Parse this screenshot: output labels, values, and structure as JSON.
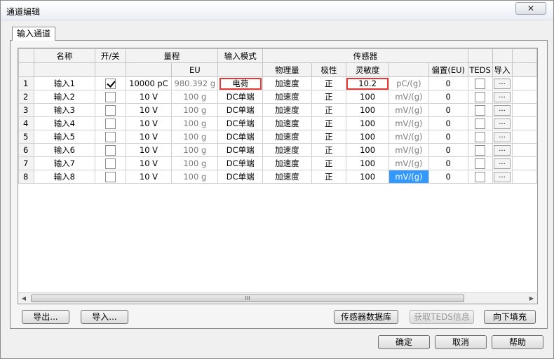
{
  "window": {
    "title": "通道编辑",
    "close_label": "✕"
  },
  "tab": {
    "label": "输入通道"
  },
  "headers": {
    "name": "名称",
    "onoff": "开/关",
    "range": "量程",
    "input_mode": "输入模式",
    "sensor": "传感器",
    "eu": "EU",
    "physical": "物理量",
    "polarity": "极性",
    "sensitivity": "灵敏度",
    "offset": "偏置(EU)",
    "teds": "TEDS",
    "import": "导入"
  },
  "rows": [
    {
      "num": "1",
      "name": "输入1",
      "checked": true,
      "range": "10000 pC",
      "eu": "980.392 g",
      "mode": "电荷",
      "phys": "加速度",
      "pol": "正",
      "sens": "10.2",
      "unit": "pC/(g)",
      "offset": "0",
      "btn": "..."
    },
    {
      "num": "2",
      "name": "输入2",
      "checked": false,
      "range": "10 V",
      "eu": "100 g",
      "mode": "DC单端",
      "phys": "加速度",
      "pol": "正",
      "sens": "100",
      "unit": "mV/(g)",
      "offset": "0",
      "btn": "..."
    },
    {
      "num": "3",
      "name": "输入3",
      "checked": false,
      "range": "10 V",
      "eu": "100 g",
      "mode": "DC单端",
      "phys": "加速度",
      "pol": "正",
      "sens": "100",
      "unit": "mV/(g)",
      "offset": "0",
      "btn": "..."
    },
    {
      "num": "4",
      "name": "输入4",
      "checked": false,
      "range": "10 V",
      "eu": "100 g",
      "mode": "DC单端",
      "phys": "加速度",
      "pol": "正",
      "sens": "100",
      "unit": "mV/(g)",
      "offset": "0",
      "btn": "..."
    },
    {
      "num": "5",
      "name": "输入5",
      "checked": false,
      "range": "10 V",
      "eu": "100 g",
      "mode": "DC单端",
      "phys": "加速度",
      "pol": "正",
      "sens": "100",
      "unit": "mV/(g)",
      "offset": "0",
      "btn": "..."
    },
    {
      "num": "6",
      "name": "输入6",
      "checked": false,
      "range": "10 V",
      "eu": "100 g",
      "mode": "DC单端",
      "phys": "加速度",
      "pol": "正",
      "sens": "100",
      "unit": "mV/(g)",
      "offset": "0",
      "btn": "..."
    },
    {
      "num": "7",
      "name": "输入7",
      "checked": false,
      "range": "10 V",
      "eu": "100 g",
      "mode": "DC单端",
      "phys": "加速度",
      "pol": "正",
      "sens": "100",
      "unit": "mV/(g)",
      "offset": "0",
      "btn": "..."
    },
    {
      "num": "8",
      "name": "输入8",
      "checked": false,
      "range": "10 V",
      "eu": "100 g",
      "mode": "DC单端",
      "phys": "加速度",
      "pol": "正",
      "sens": "100",
      "unit": "mV/(g)",
      "offset": "0",
      "btn": "..."
    }
  ],
  "scroll": {
    "left_arrow": "◀",
    "right_arrow": "▶",
    "thumb_grip": "III"
  },
  "panel_buttons": {
    "export": "导出...",
    "import": "导入...",
    "sensor_db": "传感器数据库",
    "teds_info": "获取TEDS信息",
    "fill_down": "向下填充"
  },
  "dialog_buttons": {
    "ok": "确定",
    "cancel": "取消",
    "help": "帮助"
  },
  "colors": {
    "selection": "#3399ff",
    "highlight_box": "#e53935"
  }
}
